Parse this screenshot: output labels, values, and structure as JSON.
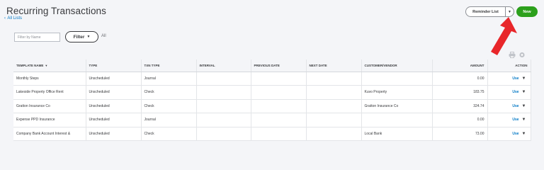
{
  "page": {
    "title": "Recurring Transactions",
    "back_link": "All Lists"
  },
  "header_actions": {
    "reminder_label": "Reminder List",
    "new_label": "New",
    "new_color": "#2ca01c",
    "arrow_color": "#e8262a"
  },
  "filters": {
    "name_placeholder": "Filter by Name",
    "filter_label": "Filter",
    "all_label": "All"
  },
  "table": {
    "columns": [
      "TEMPLATE NAME",
      "TYPE",
      "TXN TYPE",
      "INTERVAL",
      "PREVIOUS DATE",
      "NEXT DATE",
      "CUSTOMER/VENDOR",
      "AMOUNT",
      "ACTION"
    ],
    "rows": [
      {
        "name": "Monthly Steps",
        "type": "Unscheduled",
        "txn_type": "Journal",
        "interval": "",
        "prev_date": "",
        "next_date": "",
        "customer": "",
        "amount": "0.00",
        "action": "Use"
      },
      {
        "name": "Lakeside Property Office Rent",
        "type": "Unscheduled",
        "txn_type": "Check",
        "interval": "",
        "prev_date": "",
        "next_date": "",
        "customer": "Kuvo Property",
        "amount": "183.75",
        "action": "Use"
      },
      {
        "name": "Gratton Insurance Co",
        "type": "Unscheduled",
        "txn_type": "Check",
        "interval": "",
        "prev_date": "",
        "next_date": "",
        "customer": "Gratton Insurance Co",
        "amount": "324.74",
        "action": "Use"
      },
      {
        "name": "Expense PPD Insurance",
        "type": "Unscheduled",
        "txn_type": "Journal",
        "interval": "",
        "prev_date": "",
        "next_date": "",
        "customer": "",
        "amount": "0.00",
        "action": "Use"
      },
      {
        "name": "Company Bank Account Interest &",
        "type": "Unscheduled",
        "txn_type": "Check",
        "interval": "",
        "prev_date": "",
        "next_date": "",
        "customer": "Local Bank",
        "amount": "73.00",
        "action": "Use"
      }
    ]
  }
}
